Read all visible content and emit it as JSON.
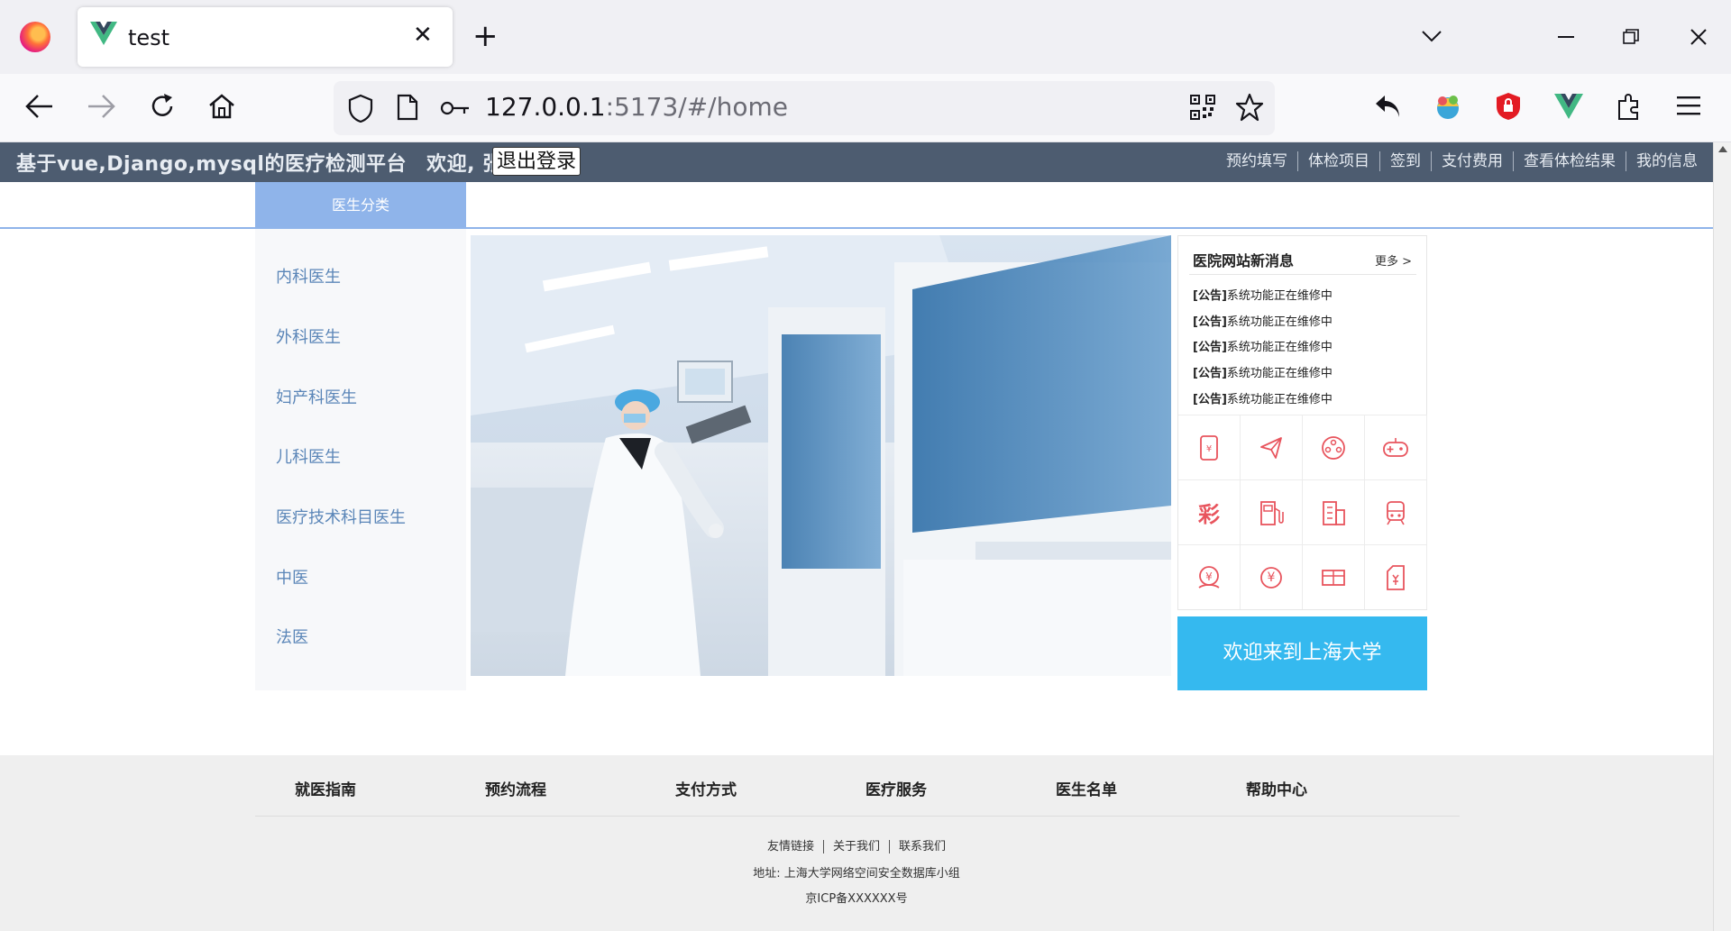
{
  "browser": {
    "tab_title": "test",
    "url_host": "127.0.0.1",
    "url_rest": ":5173/#/home"
  },
  "header": {
    "site_title": "基于vue,Django,mysql的医疗检测平台",
    "welcome": "欢迎, 张三",
    "logout": "退出登录",
    "nav": [
      "预约填写",
      "体检项目",
      "签到",
      "支付费用",
      "查看体检结果",
      "我的信息"
    ]
  },
  "category": {
    "header": "医生分类",
    "items": [
      "内科医生",
      "外科医生",
      "妇产科医生",
      "儿科医生",
      "医疗技术科目医生",
      "中医",
      "法医"
    ]
  },
  "news": {
    "title": "医院网站新消息",
    "more": "更多 >",
    "items": [
      {
        "tag": "[公告]",
        "text": "系统功能正在维修中"
      },
      {
        "tag": "[公告]",
        "text": "系统功能正在维修中"
      },
      {
        "tag": "[公告]",
        "text": "系统功能正在维修中"
      },
      {
        "tag": "[公告]",
        "text": "系统功能正在维修中"
      },
      {
        "tag": "[公告]",
        "text": "系统功能正在维修中"
      }
    ],
    "grid_icons": [
      "phone-payment-icon",
      "airplane-icon",
      "film-reel-icon",
      "game-controller-icon",
      "lottery-icon",
      "fuel-pump-icon",
      "building-icon",
      "train-icon",
      "money-bag-icon",
      "yuan-coin-icon",
      "ticket-icon",
      "invoice-icon"
    ],
    "lottery_char": "彩",
    "yuan_char": "¥"
  },
  "welcome_box": "欢迎来到上海大学",
  "footer": {
    "links": [
      "就医指南",
      "预约流程",
      "支付方式",
      "医疗服务",
      "医生名单",
      "帮助中心"
    ],
    "friend_links": [
      "友情链接",
      "关于我们",
      "联系我们"
    ],
    "address": "地址: 上海大学网络空间安全数据库小组",
    "icp": "京ICP备XXXXXX号"
  },
  "colors": {
    "header_bg": "#4d5c70",
    "accent_blue": "#8fb4ea",
    "welcome_bg": "#35b9ef",
    "icon_red": "#e8545d"
  }
}
